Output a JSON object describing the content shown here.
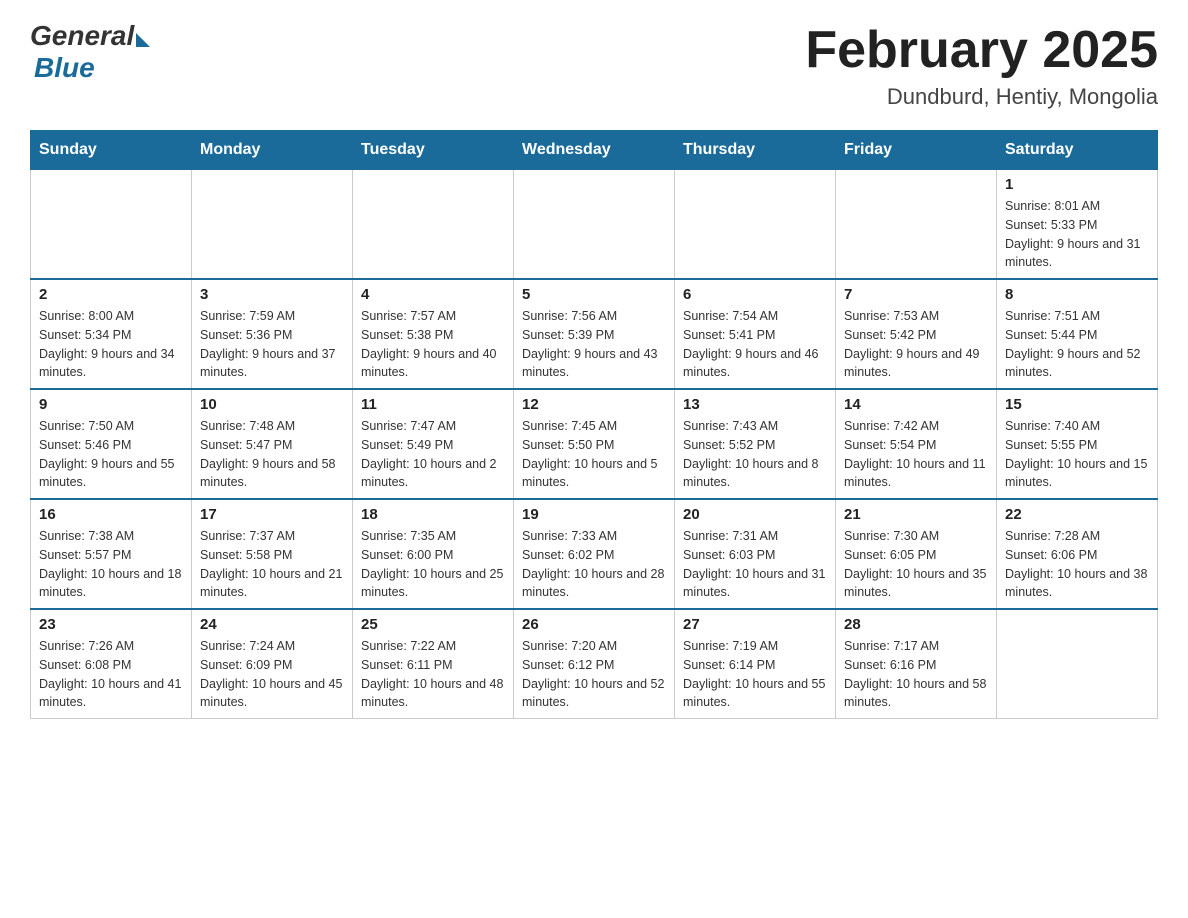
{
  "header": {
    "logo_general": "General",
    "logo_blue": "Blue",
    "title": "February 2025",
    "location": "Dundburd, Hentiy, Mongolia"
  },
  "days_of_week": [
    "Sunday",
    "Monday",
    "Tuesday",
    "Wednesday",
    "Thursday",
    "Friday",
    "Saturday"
  ],
  "weeks": [
    [
      {
        "day": "",
        "info": ""
      },
      {
        "day": "",
        "info": ""
      },
      {
        "day": "",
        "info": ""
      },
      {
        "day": "",
        "info": ""
      },
      {
        "day": "",
        "info": ""
      },
      {
        "day": "",
        "info": ""
      },
      {
        "day": "1",
        "info": "Sunrise: 8:01 AM\nSunset: 5:33 PM\nDaylight: 9 hours and 31 minutes."
      }
    ],
    [
      {
        "day": "2",
        "info": "Sunrise: 8:00 AM\nSunset: 5:34 PM\nDaylight: 9 hours and 34 minutes."
      },
      {
        "day": "3",
        "info": "Sunrise: 7:59 AM\nSunset: 5:36 PM\nDaylight: 9 hours and 37 minutes."
      },
      {
        "day": "4",
        "info": "Sunrise: 7:57 AM\nSunset: 5:38 PM\nDaylight: 9 hours and 40 minutes."
      },
      {
        "day": "5",
        "info": "Sunrise: 7:56 AM\nSunset: 5:39 PM\nDaylight: 9 hours and 43 minutes."
      },
      {
        "day": "6",
        "info": "Sunrise: 7:54 AM\nSunset: 5:41 PM\nDaylight: 9 hours and 46 minutes."
      },
      {
        "day": "7",
        "info": "Sunrise: 7:53 AM\nSunset: 5:42 PM\nDaylight: 9 hours and 49 minutes."
      },
      {
        "day": "8",
        "info": "Sunrise: 7:51 AM\nSunset: 5:44 PM\nDaylight: 9 hours and 52 minutes."
      }
    ],
    [
      {
        "day": "9",
        "info": "Sunrise: 7:50 AM\nSunset: 5:46 PM\nDaylight: 9 hours and 55 minutes."
      },
      {
        "day": "10",
        "info": "Sunrise: 7:48 AM\nSunset: 5:47 PM\nDaylight: 9 hours and 58 minutes."
      },
      {
        "day": "11",
        "info": "Sunrise: 7:47 AM\nSunset: 5:49 PM\nDaylight: 10 hours and 2 minutes."
      },
      {
        "day": "12",
        "info": "Sunrise: 7:45 AM\nSunset: 5:50 PM\nDaylight: 10 hours and 5 minutes."
      },
      {
        "day": "13",
        "info": "Sunrise: 7:43 AM\nSunset: 5:52 PM\nDaylight: 10 hours and 8 minutes."
      },
      {
        "day": "14",
        "info": "Sunrise: 7:42 AM\nSunset: 5:54 PM\nDaylight: 10 hours and 11 minutes."
      },
      {
        "day": "15",
        "info": "Sunrise: 7:40 AM\nSunset: 5:55 PM\nDaylight: 10 hours and 15 minutes."
      }
    ],
    [
      {
        "day": "16",
        "info": "Sunrise: 7:38 AM\nSunset: 5:57 PM\nDaylight: 10 hours and 18 minutes."
      },
      {
        "day": "17",
        "info": "Sunrise: 7:37 AM\nSunset: 5:58 PM\nDaylight: 10 hours and 21 minutes."
      },
      {
        "day": "18",
        "info": "Sunrise: 7:35 AM\nSunset: 6:00 PM\nDaylight: 10 hours and 25 minutes."
      },
      {
        "day": "19",
        "info": "Sunrise: 7:33 AM\nSunset: 6:02 PM\nDaylight: 10 hours and 28 minutes."
      },
      {
        "day": "20",
        "info": "Sunrise: 7:31 AM\nSunset: 6:03 PM\nDaylight: 10 hours and 31 minutes."
      },
      {
        "day": "21",
        "info": "Sunrise: 7:30 AM\nSunset: 6:05 PM\nDaylight: 10 hours and 35 minutes."
      },
      {
        "day": "22",
        "info": "Sunrise: 7:28 AM\nSunset: 6:06 PM\nDaylight: 10 hours and 38 minutes."
      }
    ],
    [
      {
        "day": "23",
        "info": "Sunrise: 7:26 AM\nSunset: 6:08 PM\nDaylight: 10 hours and 41 minutes."
      },
      {
        "day": "24",
        "info": "Sunrise: 7:24 AM\nSunset: 6:09 PM\nDaylight: 10 hours and 45 minutes."
      },
      {
        "day": "25",
        "info": "Sunrise: 7:22 AM\nSunset: 6:11 PM\nDaylight: 10 hours and 48 minutes."
      },
      {
        "day": "26",
        "info": "Sunrise: 7:20 AM\nSunset: 6:12 PM\nDaylight: 10 hours and 52 minutes."
      },
      {
        "day": "27",
        "info": "Sunrise: 7:19 AM\nSunset: 6:14 PM\nDaylight: 10 hours and 55 minutes."
      },
      {
        "day": "28",
        "info": "Sunrise: 7:17 AM\nSunset: 6:16 PM\nDaylight: 10 hours and 58 minutes."
      },
      {
        "day": "",
        "info": ""
      }
    ]
  ]
}
